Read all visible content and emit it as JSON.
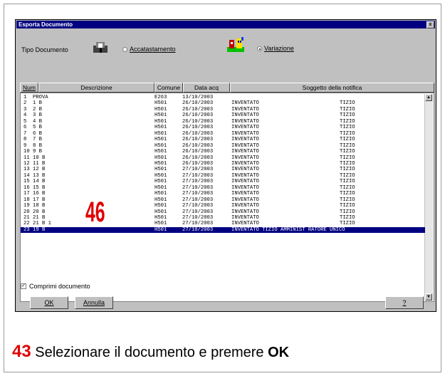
{
  "dialog": {
    "title": "Esporta Documento",
    "close_glyph": "x",
    "tipo_label": "Tipo Documento",
    "options": [
      {
        "label": "Accatastamento",
        "selected": false
      },
      {
        "label": "Variazione",
        "selected": true
      }
    ],
    "columns": [
      "Num",
      "Descrizione",
      "Comune",
      "Data acq",
      "Soggetto della notifica"
    ],
    "rows": [
      {
        "num": "1",
        "descr": "PROVA",
        "comune": "E263",
        "data": "13/10/2003",
        "soggetto": "",
        "nome": "",
        "selected": false
      },
      {
        "num": "2",
        "descr": "1 B",
        "comune": "H501",
        "data": "26/10/2003",
        "soggetto": "INVENTATO",
        "nome": "TIZIO",
        "selected": false
      },
      {
        "num": "3",
        "descr": "2 B",
        "comune": "H501",
        "data": "26/10/2003",
        "soggetto": "INVENTATO",
        "nome": "TIZIO",
        "selected": false
      },
      {
        "num": "4",
        "descr": "3 B",
        "comune": "H501",
        "data": "26/10/2003",
        "soggetto": "INVENTATO",
        "nome": "TIZIO",
        "selected": false
      },
      {
        "num": "5",
        "descr": "4 B",
        "comune": "H501",
        "data": "26/10/2003",
        "soggetto": "INVENTATO",
        "nome": "TIZIO",
        "selected": false
      },
      {
        "num": "6",
        "descr": "5 B",
        "comune": "H501",
        "data": "26/10/2003",
        "soggetto": "INVENTATO",
        "nome": "TIZIO",
        "selected": false
      },
      {
        "num": "7",
        "descr": "6 B",
        "comune": "H501",
        "data": "26/10/2003",
        "soggetto": "INVENTATO",
        "nome": "TIZIO",
        "selected": false
      },
      {
        "num": "8",
        "descr": "7 B",
        "comune": "H501",
        "data": "26/10/2003",
        "soggetto": "INVENTATO",
        "nome": "TIZIO",
        "selected": false
      },
      {
        "num": "9",
        "descr": "8 B",
        "comune": "H501",
        "data": "26/10/2003",
        "soggetto": "INVENTATO",
        "nome": "TIZIO",
        "selected": false
      },
      {
        "num": "10",
        "descr": "9 B",
        "comune": "H501",
        "data": "26/10/2003",
        "soggetto": "INVENTATO",
        "nome": "TIZIO",
        "selected": false
      },
      {
        "num": "11",
        "descr": "10 B",
        "comune": "H501",
        "data": "26/10/2003",
        "soggetto": "INVENTATO",
        "nome": "TIZIO",
        "selected": false
      },
      {
        "num": "12",
        "descr": "11 B",
        "comune": "H501",
        "data": "26/10/2003",
        "soggetto": "INVENTATO",
        "nome": "TIZIO",
        "selected": false
      },
      {
        "num": "13",
        "descr": "12 B",
        "comune": "H501",
        "data": "27/10/2003",
        "soggetto": "INVENTATO",
        "nome": "TIZIO",
        "selected": false
      },
      {
        "num": "14",
        "descr": "13 B",
        "comune": "H501",
        "data": "27/10/2003",
        "soggetto": "INVENTATO",
        "nome": "TIZIO",
        "selected": false
      },
      {
        "num": "15",
        "descr": "14 B",
        "comune": "H501",
        "data": "27/10/2003",
        "soggetto": "INVENTATO",
        "nome": "TIZIO",
        "selected": false
      },
      {
        "num": "16",
        "descr": "15 B",
        "comune": "H501",
        "data": "27/10/2003",
        "soggetto": "INVENTATO",
        "nome": "TIZIO",
        "selected": false
      },
      {
        "num": "17",
        "descr": "16 B",
        "comune": "H501",
        "data": "27/10/2003",
        "soggetto": "INVENTATO",
        "nome": "TIZIO",
        "selected": false
      },
      {
        "num": "18",
        "descr": "17 B",
        "comune": "H501",
        "data": "27/10/2003",
        "soggetto": "INVENTATO",
        "nome": "TIZIO",
        "selected": false
      },
      {
        "num": "19",
        "descr": "18 B",
        "comune": "H501",
        "data": "27/10/2003",
        "soggetto": "INVENTATO",
        "nome": "TIZIO",
        "selected": false
      },
      {
        "num": "20",
        "descr": "20 B",
        "comune": "H501",
        "data": "27/10/2003",
        "soggetto": "INVENTATO",
        "nome": "TIZIO",
        "selected": false
      },
      {
        "num": "21",
        "descr": "21 B",
        "comune": "H501",
        "data": "27/10/2003",
        "soggetto": "INVENTATO",
        "nome": "TIZIO",
        "selected": false
      },
      {
        "num": "22",
        "descr": "21 B 1",
        "comune": "H501",
        "data": "27/10/2003",
        "soggetto": "INVENTATO",
        "nome": "TIZIO",
        "selected": false
      },
      {
        "num": "23",
        "descr": "19 B",
        "comune": "H501",
        "data": "27/10/2003",
        "soggetto": "INVENTATO TIZIO AMMINIST RATORE UNICO",
        "nome": "",
        "selected": true
      }
    ],
    "callout_number": "46",
    "checkbox_label": "Comprimi documento",
    "checkbox_checked": true,
    "ok_label": "OK",
    "annulla_label": "Annulla",
    "help_label": "?"
  },
  "caption": {
    "number": "43",
    "text": " Selezionare il documento e premere ",
    "bold": "OK"
  },
  "colors": {
    "selection": "#000080",
    "callout": "#e00000",
    "dialog_bg": "#c0c0c0"
  }
}
